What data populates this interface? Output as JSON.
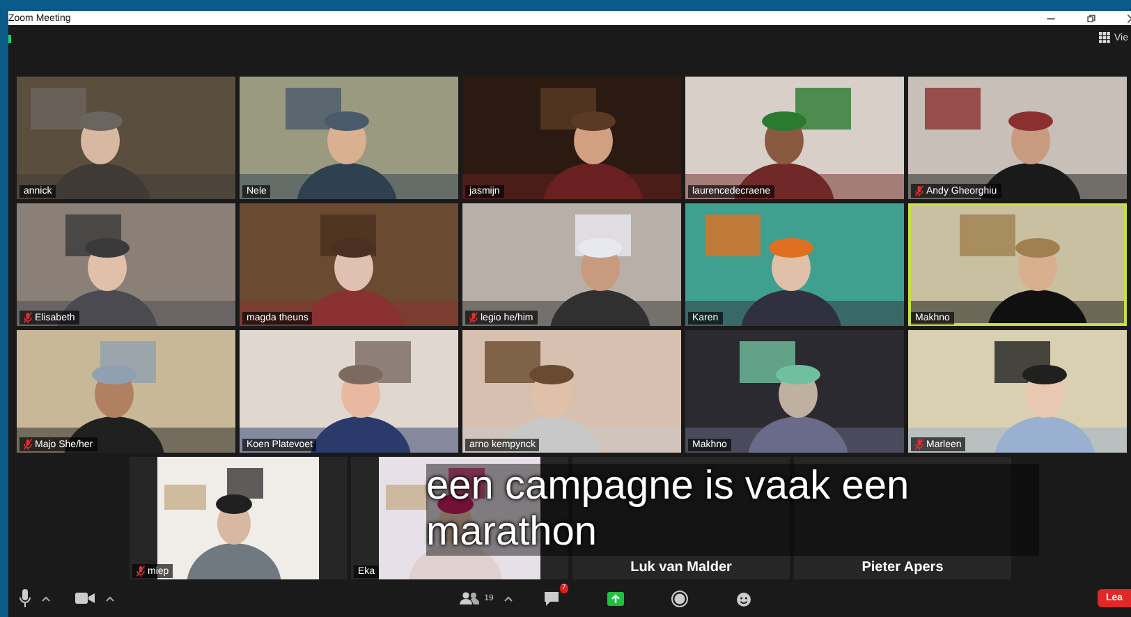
{
  "window": {
    "title": "Zoom Meeting"
  },
  "top_bar": {
    "view_label": "Vie"
  },
  "tiles": [
    {
      "name": "annick",
      "kind": "video",
      "muted": false,
      "speaking": false
    },
    {
      "name": "Nele",
      "kind": "video",
      "muted": false,
      "speaking": false
    },
    {
      "name": "jasmijn",
      "kind": "video",
      "muted": false,
      "speaking": false
    },
    {
      "name": "laurencedecraene",
      "kind": "video",
      "muted": false,
      "speaking": false
    },
    {
      "name": "Andy Gheorghiu",
      "kind": "video",
      "muted": true,
      "speaking": false
    },
    {
      "name": "Elisabeth",
      "kind": "video",
      "muted": true,
      "speaking": false
    },
    {
      "name": "magda theuns",
      "kind": "video",
      "muted": false,
      "speaking": false
    },
    {
      "name": "legio he/him",
      "kind": "video",
      "muted": true,
      "speaking": false
    },
    {
      "name": "Karen",
      "kind": "video",
      "muted": false,
      "speaking": false
    },
    {
      "name": "Makhno",
      "kind": "video",
      "muted": false,
      "speaking": true
    },
    {
      "name": "Majo She/her",
      "kind": "video",
      "muted": true,
      "speaking": false
    },
    {
      "name": "Koen Platevoet",
      "kind": "video",
      "muted": false,
      "speaking": false
    },
    {
      "name": "arno kempynck",
      "kind": "video",
      "muted": false,
      "speaking": false
    },
    {
      "name": "Makhno",
      "kind": "video",
      "muted": false,
      "speaking": false
    },
    {
      "name": "Marleen",
      "kind": "video",
      "muted": true,
      "speaking": false
    }
  ],
  "bottom_tiles": [
    {
      "name": "miep",
      "kind": "video",
      "muted": true,
      "speaking": false
    },
    {
      "name": "Eka",
      "kind": "video",
      "muted": false,
      "speaking": false
    },
    {
      "name": "Luk van Malder",
      "kind": "name",
      "speaking": false
    },
    {
      "name": "Pieter Apers",
      "kind": "name",
      "speaking": false
    }
  ],
  "caption": "een campagne is vaak een marathon",
  "toolbar": {
    "participants_count": "19",
    "chat_badge": "7",
    "leave_label": "Lea"
  }
}
